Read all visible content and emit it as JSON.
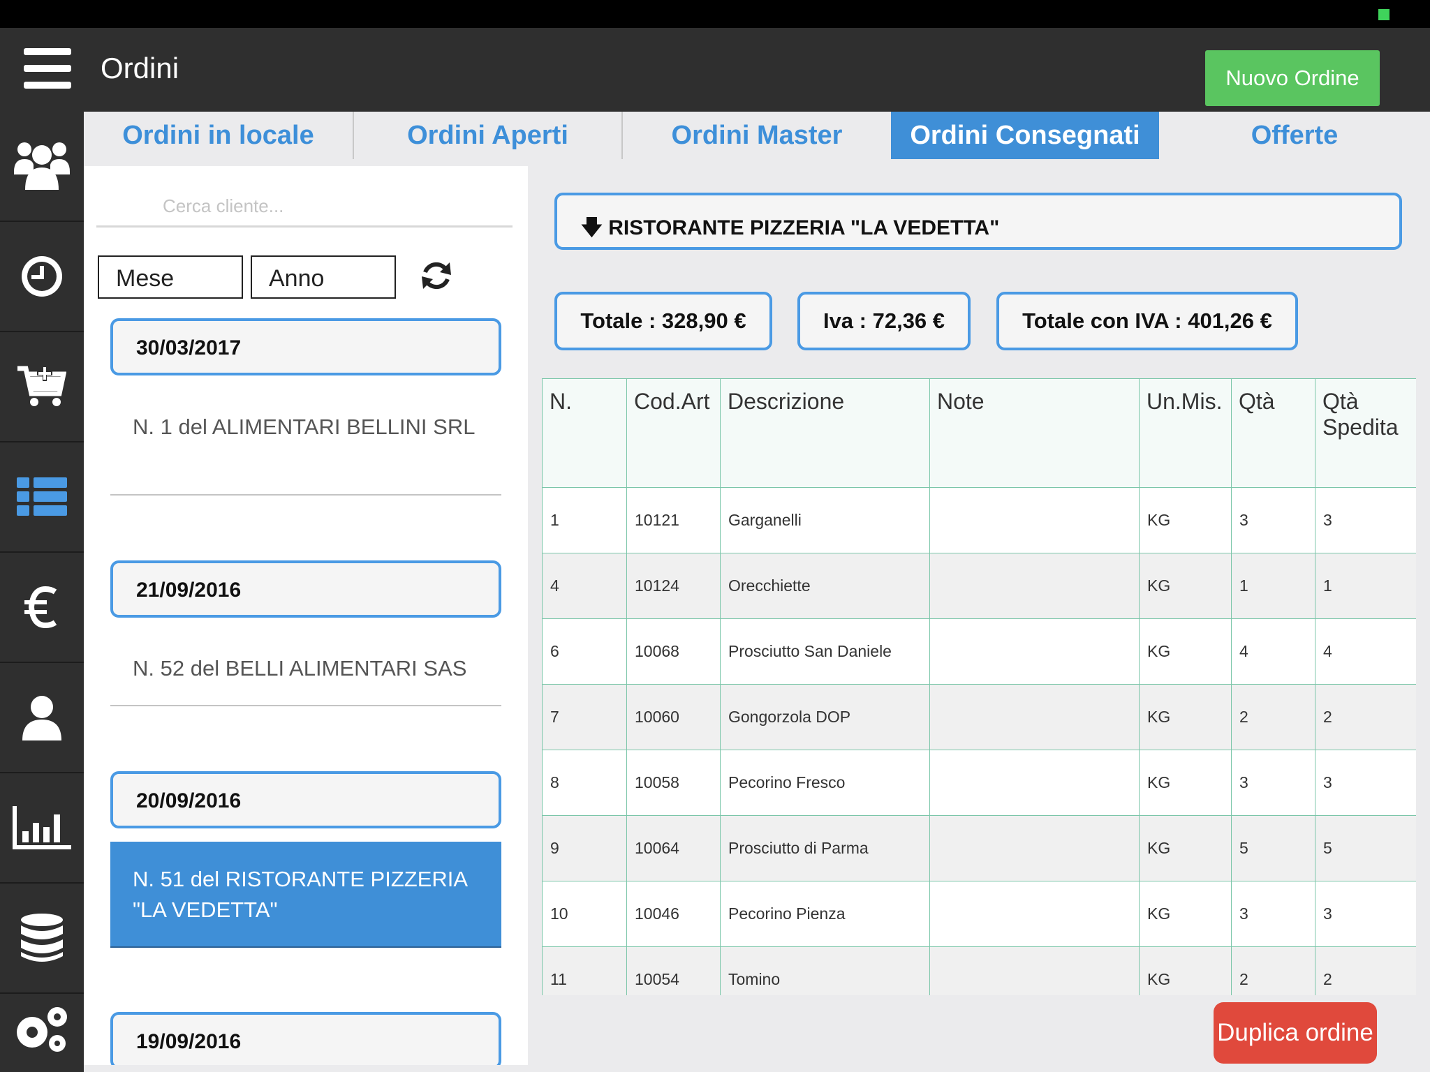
{
  "app": {
    "title": "Ordini",
    "new_order_label": "Nuovo Ordine"
  },
  "sidebar": {
    "items": [
      "users-icon",
      "clock-icon",
      "cart-add-icon",
      "list-icon",
      "euro-icon",
      "user-icon",
      "bar-chart-icon",
      "database-icon",
      "gears-icon"
    ]
  },
  "tabs": [
    "Ordini in locale",
    "Ordini Aperti",
    "Ordini Master",
    "Ordini Consegnati",
    "Offerte"
  ],
  "active_tab": "Ordini Consegnati",
  "filters": {
    "search_placeholder": "Cerca cliente...",
    "month": "Mese",
    "year": "Anno"
  },
  "orders": [
    {
      "date": "30/03/2017",
      "label": "N. 1 del ALIMENTARI BELLINI SRL"
    },
    {
      "date": "21/09/2016",
      "label": "N. 52 del BELLI ALIMENTARI SAS"
    },
    {
      "date": "20/09/2016",
      "label": "N. 51 del RISTORANTE PIZZERIA \"LA VEDETTA\""
    },
    {
      "date": "19/09/2016",
      "label": ""
    }
  ],
  "selected_client": "RISTORANTE PIZZERIA \"LA VEDETTA\"",
  "totals": {
    "totale": "Totale : 328,90 €",
    "iva": "Iva : 72,36 €",
    "totale_iva": "Totale con IVA : 401,26 €"
  },
  "table": {
    "headers": [
      "N.",
      "Cod.Art",
      "Descrizione",
      "Note",
      "Un.Mis.",
      "Qtà",
      "Qtà Spedita"
    ],
    "rows": [
      [
        "1",
        "10121",
        "Garganelli",
        "",
        "KG",
        "3",
        "3"
      ],
      [
        "4",
        "10124",
        "Orecchiette",
        "",
        "KG",
        "1",
        "1"
      ],
      [
        "6",
        "10068",
        "Prosciutto San Daniele",
        "",
        "KG",
        "4",
        "4"
      ],
      [
        "7",
        "10060",
        "Gongorzola DOP",
        "",
        "KG",
        "2",
        "2"
      ],
      [
        "8",
        "10058",
        "Pecorino Fresco",
        "",
        "KG",
        "3",
        "3"
      ],
      [
        "9",
        "10064",
        "Prosciutto di Parma",
        "",
        "KG",
        "5",
        "5"
      ],
      [
        "10",
        "10046",
        "Pecorino Pienza",
        "",
        "KG",
        "3",
        "3"
      ],
      [
        "11",
        "10054",
        "Tomino",
        "",
        "KG",
        "2",
        "2"
      ]
    ]
  },
  "duplicate_label": "Duplica ordine",
  "colors": {
    "accent": "#3f8fd7",
    "success": "#5ac560",
    "danger": "#e0493c",
    "dark": "#2f2f2f"
  }
}
